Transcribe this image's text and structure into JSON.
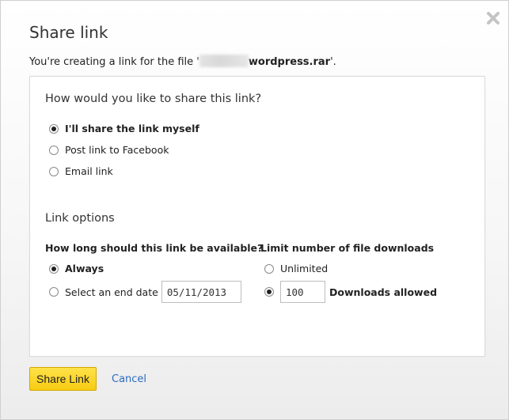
{
  "dialog": {
    "title": "Share link",
    "subtitle_prefix": "You're creating a link for the file '",
    "file_name_suffix": "wordpress.rar",
    "subtitle_end": "'.",
    "close_icon": "close-icon"
  },
  "share_method": {
    "heading": "How would you like to share this link?",
    "options": [
      {
        "label": "I'll share the link myself",
        "selected": true
      },
      {
        "label": "Post link to Facebook",
        "selected": false
      },
      {
        "label": "Email link",
        "selected": false
      }
    ]
  },
  "link_options": {
    "heading": "Link options",
    "availability": {
      "label": "How long should this link be available?",
      "always_label": "Always",
      "always_selected": true,
      "end_date_label": "Select an end date",
      "end_date_value": "05/11/2013"
    },
    "downloads": {
      "label": "Limit number of file downloads",
      "unlimited_label": "Unlimited",
      "limit_selected": true,
      "limit_value": "100",
      "limit_suffix": "Downloads allowed"
    }
  },
  "footer": {
    "share_button": "Share Link",
    "cancel_link": "Cancel",
    "accent_color": "#f7cb12",
    "link_color": "#2a6cc0"
  }
}
